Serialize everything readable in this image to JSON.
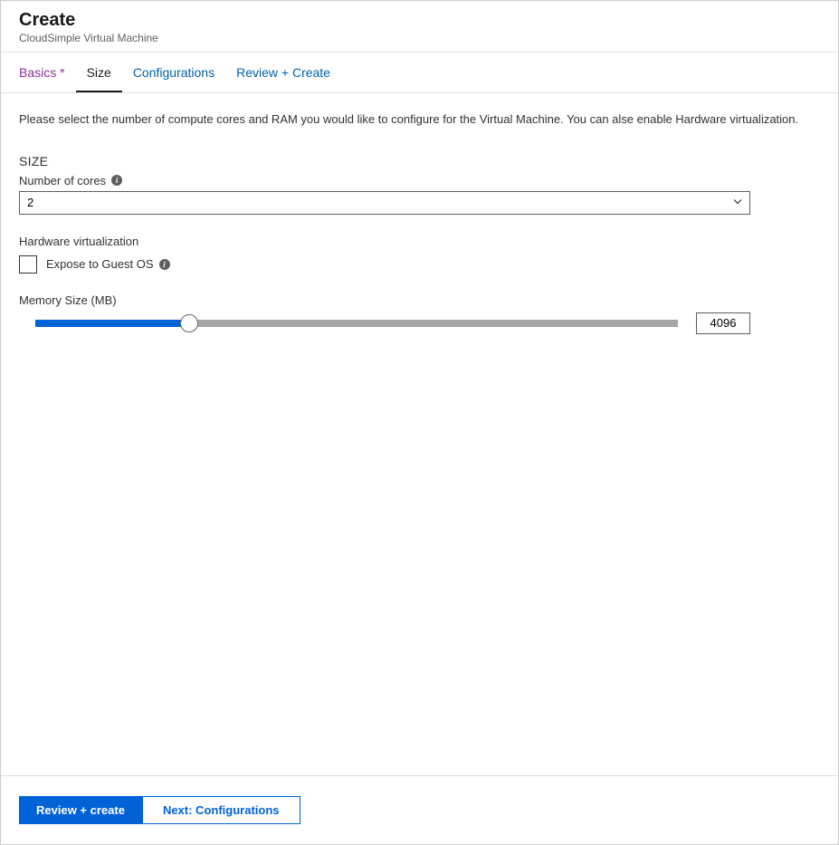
{
  "header": {
    "title": "Create",
    "subtitle": "CloudSimple Virtual Machine"
  },
  "tabs": [
    {
      "label": "Basics *",
      "state": "required"
    },
    {
      "label": "Size",
      "state": "active"
    },
    {
      "label": "Configurations",
      "state": ""
    },
    {
      "label": "Review + Create",
      "state": ""
    }
  ],
  "content": {
    "description": "Please select the number of compute cores and RAM you would like to configure for the Virtual Machine. You can alse enable Hardware virtualization.",
    "sectionHeading": "SIZE",
    "cores": {
      "label": "Number of cores",
      "value": "2"
    },
    "hwVirt": {
      "heading": "Hardware virtualization",
      "checkboxLabel": "Expose to Guest OS",
      "checked": false
    },
    "memory": {
      "label": "Memory Size (MB)",
      "value": "4096"
    }
  },
  "footer": {
    "primary": "Review + create",
    "secondary": "Next: Configurations"
  }
}
